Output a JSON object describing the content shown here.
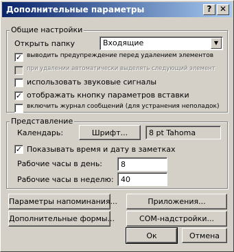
{
  "window": {
    "title": "Дополнительные параметры",
    "help_glyph": "?",
    "close_glyph": "✕"
  },
  "general": {
    "legend": "Общие настройки",
    "open_folder_label": "Открыть папку",
    "open_folder_value": "Входящие",
    "options": [
      {
        "label": "выводить предупреждение перед удалением элементов",
        "checked": true,
        "enabled": true
      },
      {
        "label": "при удалении автоматически выделять следующий элемент",
        "checked": false,
        "enabled": false
      },
      {
        "label": "использовать звуковые сигналы",
        "checked": false,
        "enabled": true
      },
      {
        "label": "отображать кнопку параметров вставки",
        "checked": true,
        "enabled": true
      },
      {
        "label": "включить журнал сообщений (для устранения неполадок)",
        "checked": false,
        "enabled": true
      }
    ]
  },
  "view": {
    "legend": "Представление",
    "calendar_label": "Календарь:",
    "font_button": "Шрифт...",
    "font_value": "8 pt Tahoma",
    "show_time_label": "Показывать время и дату в заметках",
    "show_time_checked": true,
    "hours_day_label": "Рабочие часы в день:",
    "hours_day_value": "8",
    "hours_week_label": "Рабочие часы в неделю:",
    "hours_week_value": "40"
  },
  "buttons": {
    "reminder": "Параметры напоминания...",
    "addins": "Приложения...",
    "custom_forms": "Дополнительные формы...",
    "com_addins": "COM-надстройки...",
    "ok": "Ок",
    "cancel": "Отмена"
  },
  "icons": {
    "check_glyph": "✓",
    "dropdown_glyph": "▼"
  }
}
